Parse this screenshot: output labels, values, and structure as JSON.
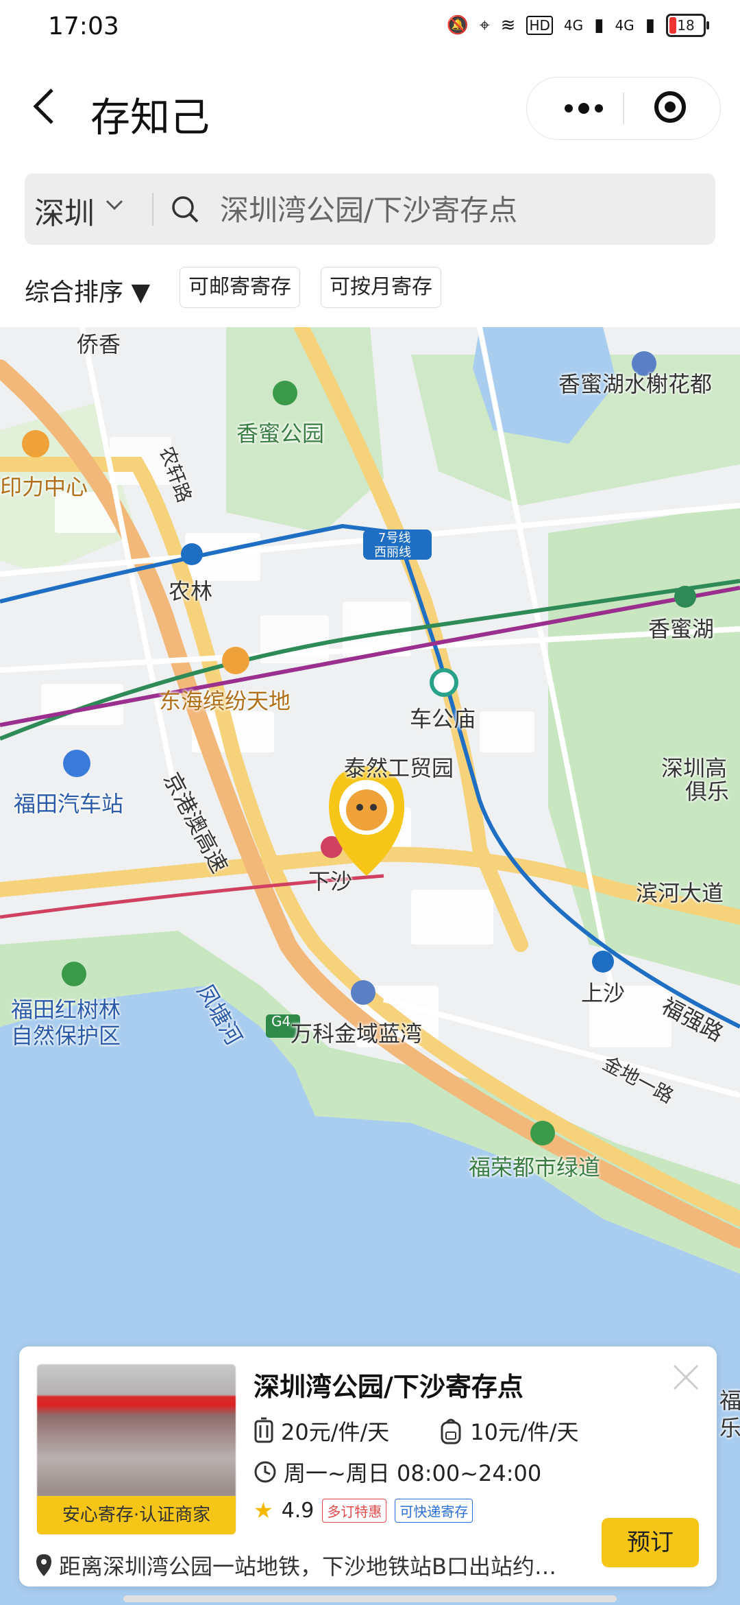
{
  "status_bar": {
    "time": "17:03",
    "battery": "18",
    "network1": "4G",
    "network2": "4G",
    "hd": "HD"
  },
  "header": {
    "title": "存知己"
  },
  "search": {
    "city": "深圳",
    "placeholder": "深圳湾公园/下沙寄存点"
  },
  "filters": {
    "sort": "综合排序 ▼",
    "chips": [
      "可邮寄寄存",
      "可按月寄存"
    ]
  },
  "map": {
    "labels": [
      "侨香",
      "香蜜湖水榭花都",
      "香蜜公园",
      "印力中心",
      "农轩路",
      "7号线",
      "西丽线",
      "农林",
      "香蜜湖",
      "东海缤纷天地",
      "车公庙",
      "福田汽车站",
      "泰然工贸园",
      "深圳高",
      "俱乐",
      "京港澳高速",
      "下沙",
      "滨河大道",
      "G4",
      "上沙",
      "福田红树林",
      "自然保护区",
      "凤塘河",
      "万科金域蓝湾",
      "福强路",
      "金地一路",
      "福荣都市绿道",
      "福",
      "乐"
    ]
  },
  "card": {
    "name": "深圳湾公园/下沙寄存点",
    "badge": "安心寄存·认证商家",
    "price_luggage": "20元/件/天",
    "price_bag": "10元/件/天",
    "hours": "周一~周日 08:00~24:00",
    "rating": "4.9",
    "tags": [
      "多订特惠",
      "可快递寄存"
    ],
    "address": "距离深圳湾公园一站地铁，下沙地铁站B口出站约…",
    "book_label": "预订"
  },
  "colors": {
    "accent": "#f5c518",
    "metro_blue": "#1e6fc4",
    "metro_green": "#2e8b57",
    "metro_purple": "#9b2f8e"
  }
}
